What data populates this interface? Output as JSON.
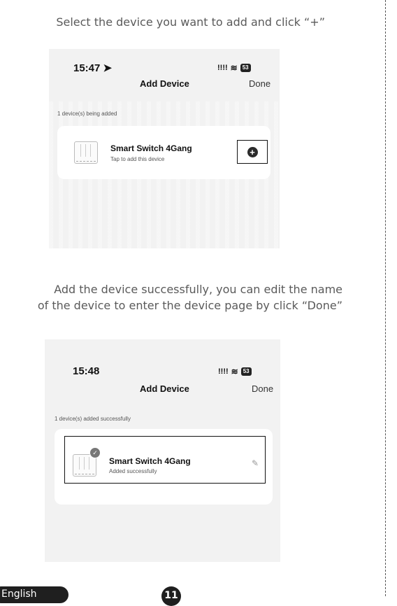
{
  "instructions": {
    "step1": "Select the device you want to add and click “+”",
    "step2_line1": "Add the device successfully, you can edit the name",
    "step2_line2": "of the device to enter the device page by click “Done”"
  },
  "screen1": {
    "time": "15:47",
    "signal": "!!!!",
    "battery": "53",
    "title": "Add Device",
    "done": "Done",
    "caption": "1 device(s) being added",
    "device_name": "Smart Switch 4Gang",
    "device_sub": "Tap to add this device",
    "add_icon": "plus-circle-icon"
  },
  "screen2": {
    "time": "15:48",
    "signal": "!!!!",
    "battery": "53",
    "title": "Add Device",
    "done": "Done",
    "caption": "1 device(s) added successfully",
    "device_name": "Smart Switch 4Gang",
    "device_sub": "Added successfully",
    "edit_icon": "pencil-icon"
  },
  "footer": {
    "language": "English",
    "page": "11"
  }
}
